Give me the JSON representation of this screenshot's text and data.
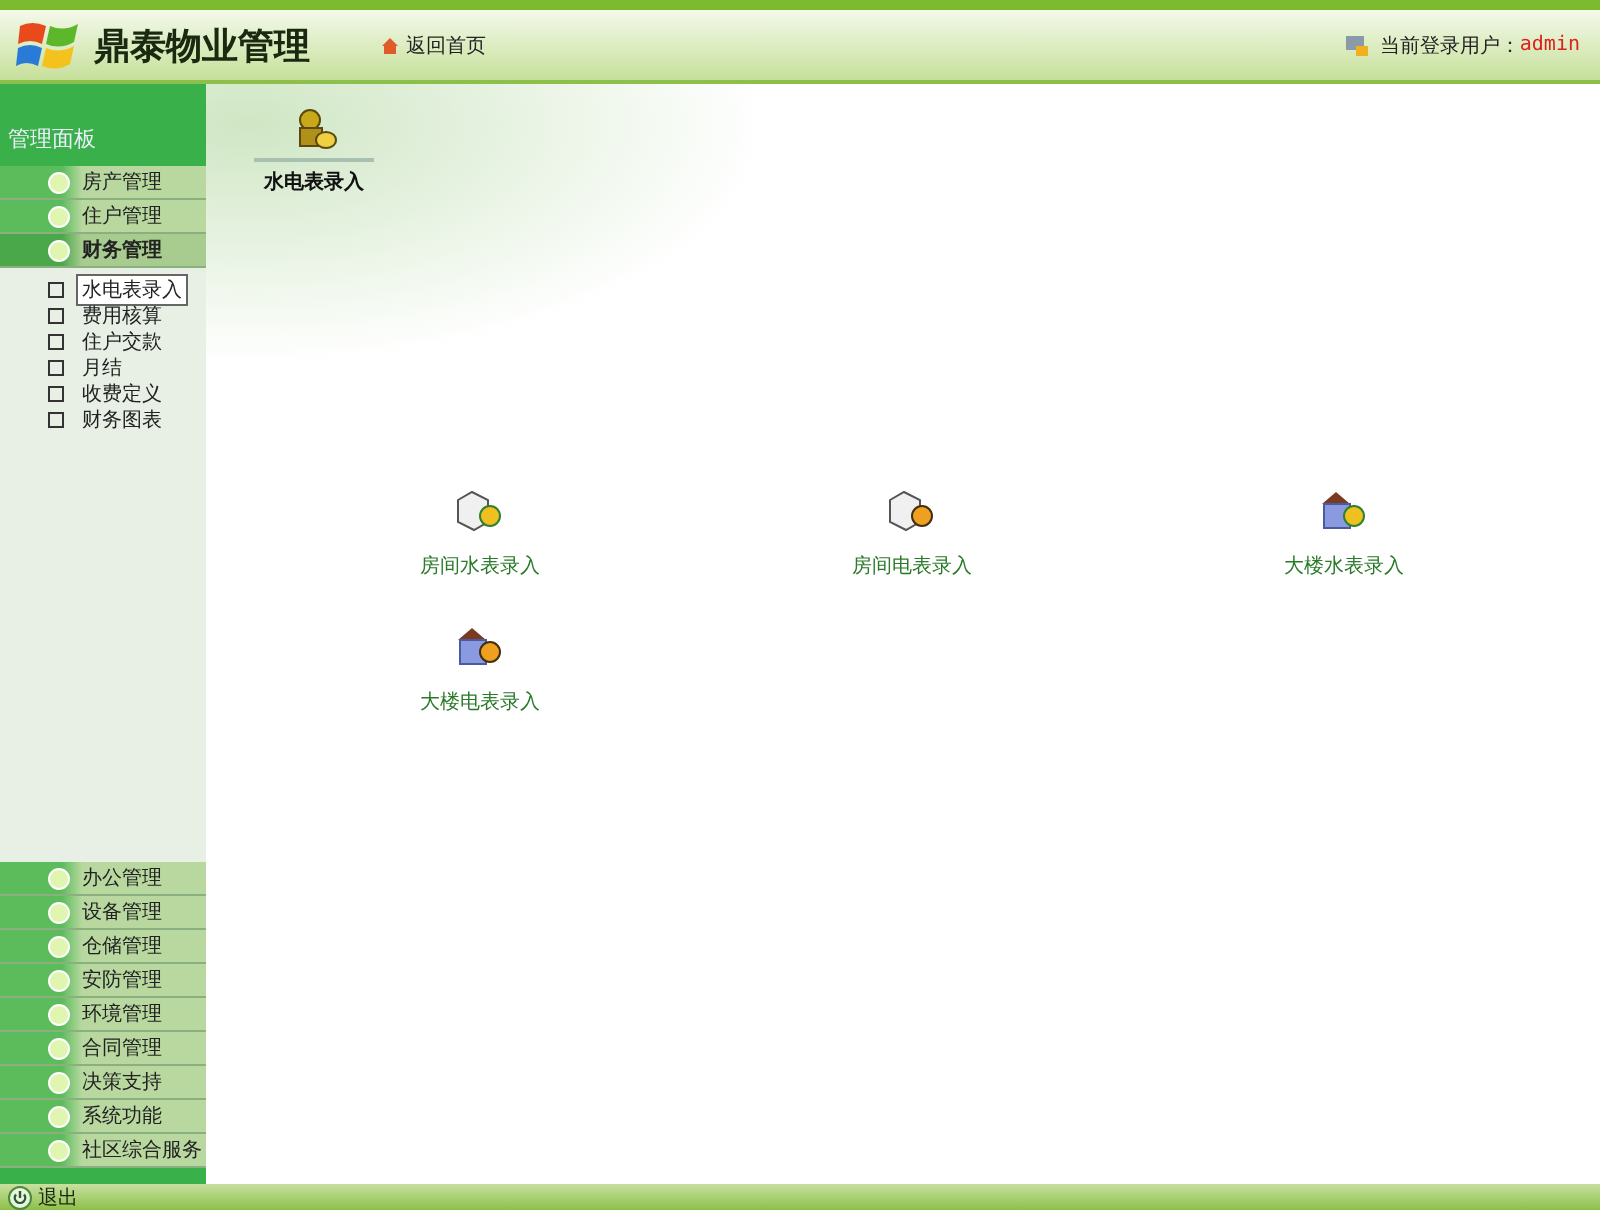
{
  "header": {
    "logo_text": "鼎泰物业管理",
    "home_link": "返回首页",
    "user_label": "当前登录用户：",
    "user_name": "admin"
  },
  "sidebar": {
    "title": "管理面板",
    "top_sections": [
      {
        "label": "房产管理",
        "expanded": false
      },
      {
        "label": "住户管理",
        "expanded": false
      },
      {
        "label": "财务管理",
        "expanded": true,
        "children": [
          {
            "label": "水电表录入",
            "selected": true
          },
          {
            "label": "费用核算",
            "selected": false
          },
          {
            "label": "住户交款",
            "selected": false
          },
          {
            "label": "月结",
            "selected": false
          },
          {
            "label": "收费定义",
            "selected": false
          },
          {
            "label": "财务图表",
            "selected": false
          }
        ]
      }
    ],
    "bottom_sections": [
      {
        "label": "办公管理"
      },
      {
        "label": "设备管理"
      },
      {
        "label": "仓储管理"
      },
      {
        "label": "安防管理"
      },
      {
        "label": "环境管理"
      },
      {
        "label": "合同管理"
      },
      {
        "label": "决策支持"
      },
      {
        "label": "系统功能"
      },
      {
        "label": "社区综合服务"
      }
    ]
  },
  "main": {
    "title": "水电表录入",
    "tiles": [
      {
        "label": "房间水表录入",
        "kind": "room-water"
      },
      {
        "label": "房间电表录入",
        "kind": "room-power"
      },
      {
        "label": "大楼水表录入",
        "kind": "building-water"
      },
      {
        "label": "大楼电表录入",
        "kind": "building-power"
      }
    ]
  },
  "footer": {
    "logout": "退出"
  }
}
